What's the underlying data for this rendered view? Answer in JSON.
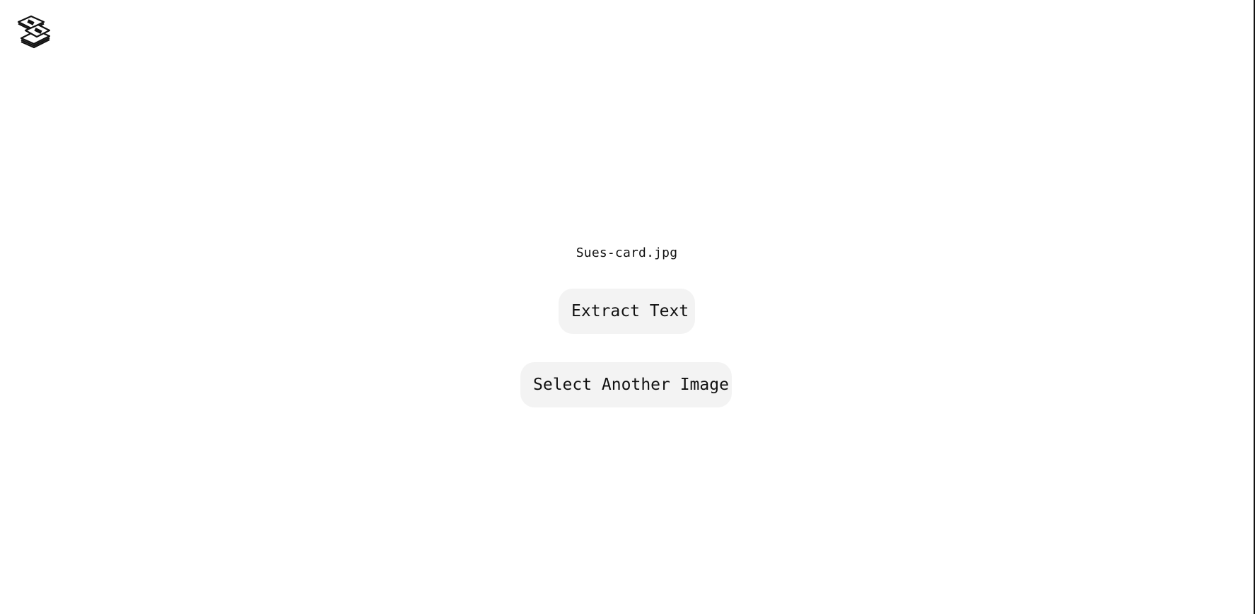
{
  "app": {
    "logo_icon": "stacked-cards-icon"
  },
  "file": {
    "name": "Sues-card.jpg"
  },
  "actions": {
    "extract_label": "Extract Text",
    "select_label": "Select Another Image"
  },
  "colors": {
    "background": "#ffffff",
    "button_bg": "#f3f3f3",
    "text": "#111111"
  }
}
